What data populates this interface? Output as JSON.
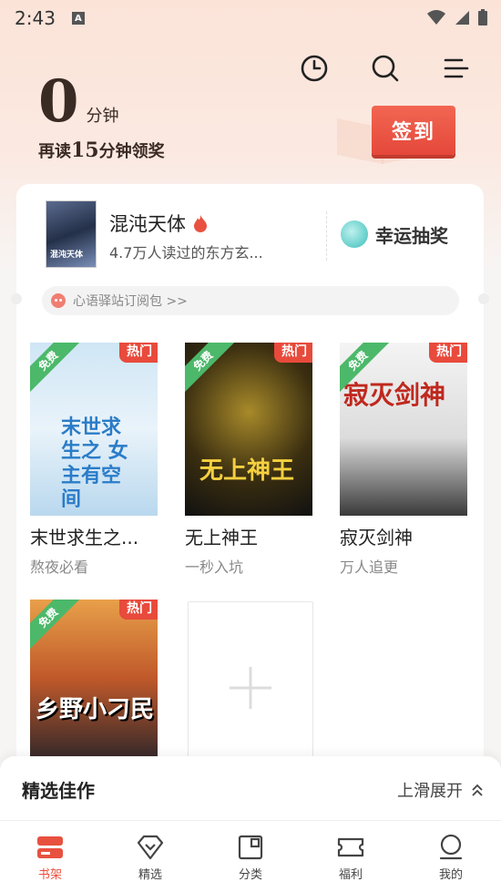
{
  "status_bar": {
    "time": "2:43"
  },
  "header": {
    "read_minutes": "0",
    "read_unit": "分钟",
    "reward_tip_prefix": "再读",
    "reward_tip_minutes": "15",
    "reward_tip_suffix": "分钟领奖",
    "signin_label": "签到"
  },
  "recommend": {
    "cover_text": "混沌天体",
    "title": "混沌天体",
    "subtitle": "4.7万人读过的东方玄...",
    "lucky_draw": "幸运抽奖"
  },
  "notice": {
    "text": "心语驿站订阅包 >>"
  },
  "shelf": {
    "books": [
      {
        "title": "末世求生之...",
        "tag": "熬夜必看",
        "free": "免费",
        "hot": "热门",
        "cover_text": "末世求生之 女主有空间"
      },
      {
        "title": "无上神王",
        "tag": "一秒入坑",
        "free": "免费",
        "hot": "热门",
        "cover_text": "无上神王"
      },
      {
        "title": "寂灭剑神",
        "tag": "万人追更",
        "free": "免费",
        "hot": "热门",
        "cover_text": "寂灭剑神"
      },
      {
        "title": "",
        "tag": "",
        "free": "免费",
        "hot": "热门",
        "cover_text": "乡野小刁民"
      }
    ]
  },
  "bottom_sheet": {
    "title": "精选佳作",
    "expand_label": "上滑展开"
  },
  "tabbar": {
    "tabs": [
      {
        "label": "书架",
        "active": true
      },
      {
        "label": "精选"
      },
      {
        "label": "分类"
      },
      {
        "label": "福利"
      },
      {
        "label": "我的"
      }
    ]
  },
  "colors": {
    "accent": "#e8513f",
    "free_tag": "#4cb86a",
    "hot_tag": "#e84a3c"
  }
}
